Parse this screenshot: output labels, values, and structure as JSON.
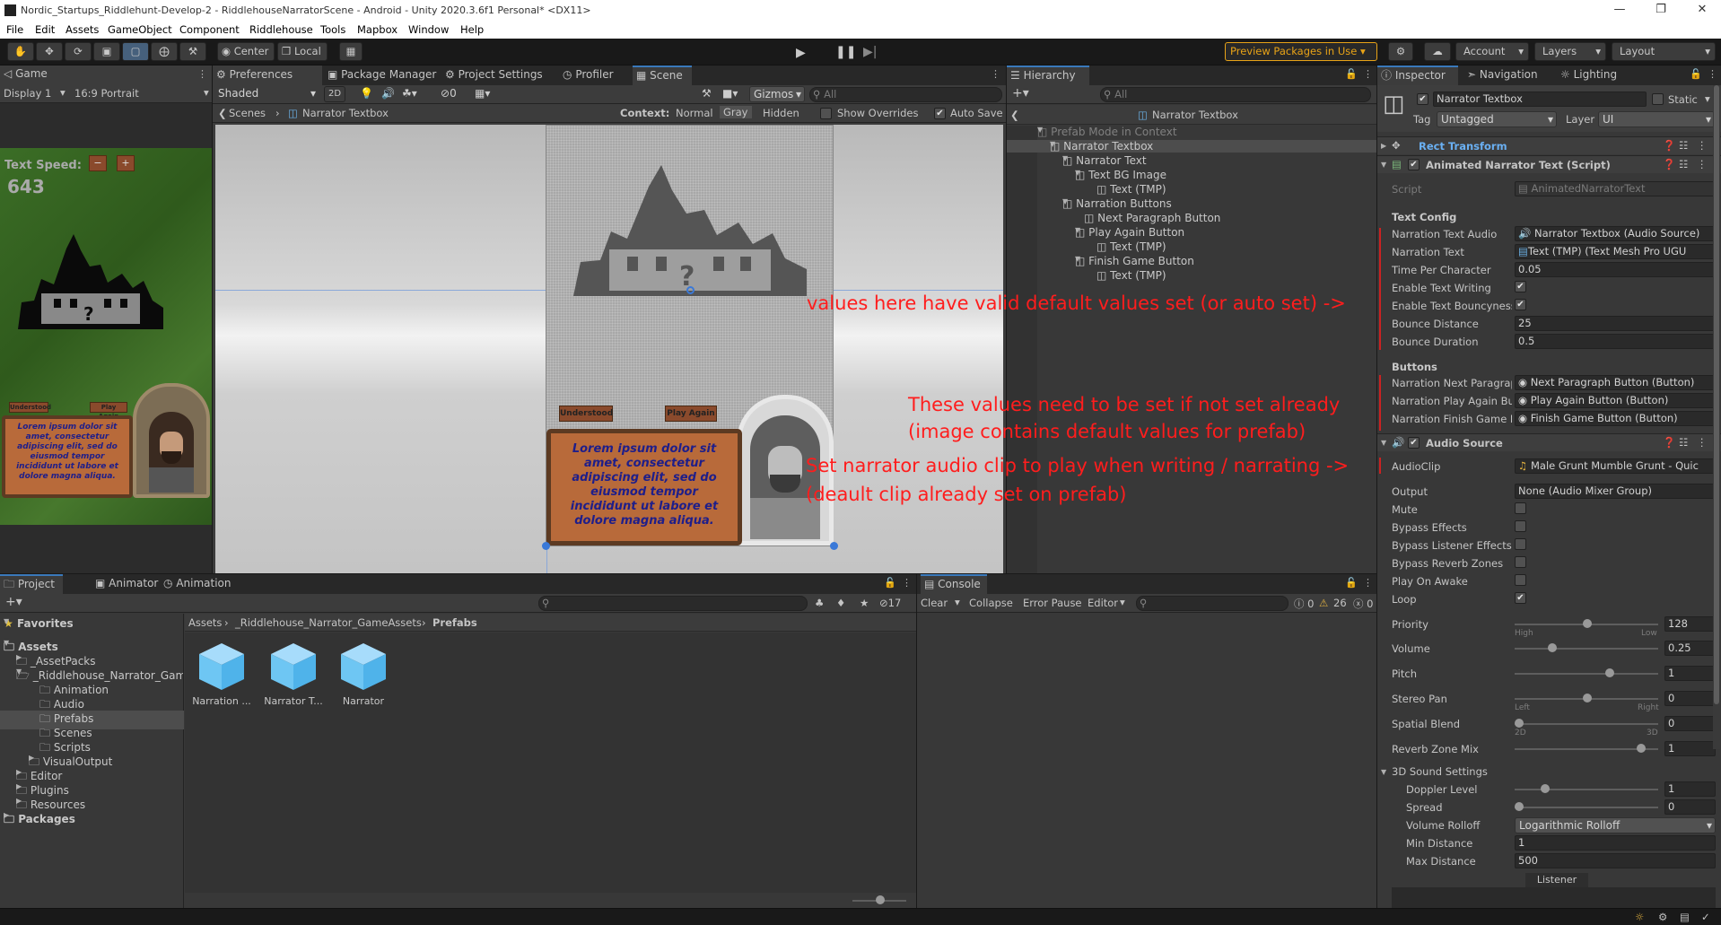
{
  "window": {
    "title": "Nordic_Startups_Riddlehunt-Develop-2 - RiddlehouseNarratorScene - Android - Unity 2020.3.6f1 Personal* <DX11>",
    "minimize": "—",
    "maximize": "❐",
    "close": "✕"
  },
  "menu": [
    "File",
    "Edit",
    "Assets",
    "GameObject",
    "Component",
    "Riddlehouse",
    "Tools",
    "Mapbox",
    "Window",
    "Help"
  ],
  "toolbar": {
    "center": "Center",
    "local": "Local",
    "preview_packages": "Preview Packages in Use",
    "account": "Account",
    "layers": "Layers",
    "layout": "Layout"
  },
  "game_panel": {
    "tab": "Game",
    "display": "Display 1",
    "aspect": "16:9 Portrait",
    "text_speed_label": "Text Speed:",
    "text_speed_value": "643",
    "btn_understood": "Understood",
    "btn_play_again": "Play Again",
    "lorem": "Lorem ipsum dolor sit amet, consectetur adipiscing elit, sed do eiusmod tempor incididunt ut labore et dolore magna aliqua."
  },
  "scene_panel": {
    "tabs": [
      "Preferences",
      "Package Manager",
      "Project Settings",
      "Profiler",
      "Scene"
    ],
    "shading": "Shaded",
    "mode_2d": "2D",
    "fx_count": "0",
    "gizmos": "Gizmos",
    "search_placeholder": "All",
    "breadcrumb_root": "Scenes",
    "breadcrumb_item": "Narrator Textbox",
    "context_label": "Context:",
    "context_normal": "Normal",
    "context_gray": "Gray",
    "context_hidden": "Hidden",
    "show_overrides": "Show Overrides",
    "auto_save": "Auto Save",
    "btn_understood": "Understood",
    "btn_play_again": "Play Again",
    "lorem": "Lorem ipsum dolor sit amet, consectetur adipiscing elit, sed do eiusmod tempor incididunt ut labore et dolore magna aliqua."
  },
  "hierarchy": {
    "tab": "Hierarchy",
    "search_placeholder": "All",
    "title": "Narrator Textbox",
    "items": [
      {
        "label": "Prefab Mode in Context",
        "depth": 0
      },
      {
        "label": "Narrator Textbox",
        "depth": 1
      },
      {
        "label": "Narrator Text",
        "depth": 2
      },
      {
        "label": "Text BG Image",
        "depth": 3
      },
      {
        "label": "Text (TMP)",
        "depth": 4
      },
      {
        "label": "Narration Buttons",
        "depth": 2
      },
      {
        "label": "Next Paragraph Button",
        "depth": 3
      },
      {
        "label": "Play Again Button",
        "depth": 3
      },
      {
        "label": "Text (TMP)",
        "depth": 4
      },
      {
        "label": "Finish Game Button",
        "depth": 3
      },
      {
        "label": "Text (TMP)",
        "depth": 4
      }
    ]
  },
  "inspector": {
    "tabs": [
      "Inspector",
      "Navigation",
      "Lighting"
    ],
    "object_name": "Narrator Textbox",
    "static_label": "Static",
    "tag_label": "Tag",
    "tag_value": "Untagged",
    "layer_label": "Layer",
    "layer_value": "UI",
    "rect_transform": "Rect Transform",
    "script_component": "Animated Narrator Text (Script)",
    "script_label": "Script",
    "script_value": "AnimatedNarratorText",
    "text_config_header": "Text Config",
    "fields": [
      {
        "label": "Narration Text Audio",
        "value": "Narrator Textbox (Audio Source)"
      },
      {
        "label": "Narration Text",
        "value": "Text (TMP) (Text Mesh Pro UGU"
      },
      {
        "label": "Time Per Character",
        "value": "0.05"
      },
      {
        "label": "Enable Text Writing",
        "value": "✔"
      },
      {
        "label": "Enable Text Bouncyness",
        "value": "✔"
      },
      {
        "label": "Bounce Distance",
        "value": "25"
      },
      {
        "label": "Bounce Duration",
        "value": "0.5"
      }
    ],
    "buttons_header": "Buttons",
    "button_fields": [
      {
        "label": "Narration Next Paragraph Button",
        "value": "Next Paragraph Button (Button)"
      },
      {
        "label": "Narration Play Again Button",
        "value": "Play Again Button (Button)"
      },
      {
        "label": "Narration Finish Game Button",
        "value": "Finish Game Button (Button)"
      }
    ],
    "audio_source": "Audio Source",
    "audio_clip_label": "AudioClip",
    "audio_clip_value": "Male Grunt Mumble Grunt - Quic",
    "output_label": "Output",
    "output_value": "None (Audio Mixer Group)",
    "toggles": [
      {
        "label": "Mute",
        "checked": ""
      },
      {
        "label": "Bypass Effects",
        "checked": ""
      },
      {
        "label": "Bypass Listener Effects",
        "checked": ""
      },
      {
        "label": "Bypass Reverb Zones",
        "checked": ""
      },
      {
        "label": "Play On Awake",
        "checked": ""
      },
      {
        "label": "Loop",
        "checked": "✔"
      }
    ],
    "priority_label": "Priority",
    "priority_value": "128",
    "priority_high": "High",
    "priority_low": "Low",
    "volume_label": "Volume",
    "volume_value": "0.25",
    "pitch_label": "Pitch",
    "pitch_value": "1",
    "stereo_label": "Stereo Pan",
    "stereo_value": "0",
    "stereo_left": "Left",
    "stereo_right": "Right",
    "spatial_label": "Spatial Blend",
    "spatial_value": "0",
    "spatial_2d": "2D",
    "spatial_3d": "3D",
    "reverb_label": "Reverb Zone Mix",
    "reverb_value": "1",
    "sound3d_header": "3D Sound Settings",
    "doppler_label": "Doppler Level",
    "doppler_value": "1",
    "spread_label": "Spread",
    "spread_value": "0",
    "rolloff_label": "Volume Rolloff",
    "rolloff_value": "Logarithmic Rolloff",
    "min_label": "Min Distance",
    "min_value": "1",
    "max_label": "Max Distance",
    "max_value": "500",
    "listener": "Listener"
  },
  "annotations": {
    "note1": "values here have valid default values set (or auto set) ->",
    "note2_line1": "These values need to be set if not set already",
    "note2_line2": "(image contains default values for prefab)",
    "note3_line1": "Set narrator audio clip to play when writing / narrating ->",
    "note3_line2": "(deault clip already set on prefab)"
  },
  "project": {
    "tabs": [
      "Project",
      "Animator",
      "Animation"
    ],
    "hidden_count": "17",
    "favorites": "Favorites",
    "tree": [
      {
        "label": "Assets",
        "depth": 0,
        "bold": true
      },
      {
        "label": "_AssetPacks",
        "depth": 1
      },
      {
        "label": "_Riddlehouse_Narrator_GameAssets",
        "depth": 1
      },
      {
        "label": "Animation",
        "depth": 2
      },
      {
        "label": "Audio",
        "depth": 2
      },
      {
        "label": "Prefabs",
        "depth": 2
      },
      {
        "label": "Scenes",
        "depth": 2
      },
      {
        "label": "Scripts",
        "depth": 2
      },
      {
        "label": "VisualOutput",
        "depth": 2
      },
      {
        "label": "Editor",
        "depth": 1
      },
      {
        "label": "Plugins",
        "depth": 1
      },
      {
        "label": "Resources",
        "depth": 1
      },
      {
        "label": "Packages",
        "depth": 0,
        "bold": true
      }
    ],
    "breadcrumb": [
      "Assets",
      "_Riddlehouse_Narrator_GameAssets",
      "Prefabs"
    ],
    "assets": [
      "Narration ...",
      "Narrator T...",
      "Narrator"
    ]
  },
  "console": {
    "tab": "Console",
    "clear": "Clear",
    "collapse": "Collapse",
    "error_pause": "Error Pause",
    "editor": "Editor",
    "info_count": "0",
    "warn_count": "26",
    "error_count": "0"
  },
  "colors": {
    "accent": "#3a79bb",
    "annotation": "#ff1d1d",
    "preview_border": "#e8a317"
  }
}
